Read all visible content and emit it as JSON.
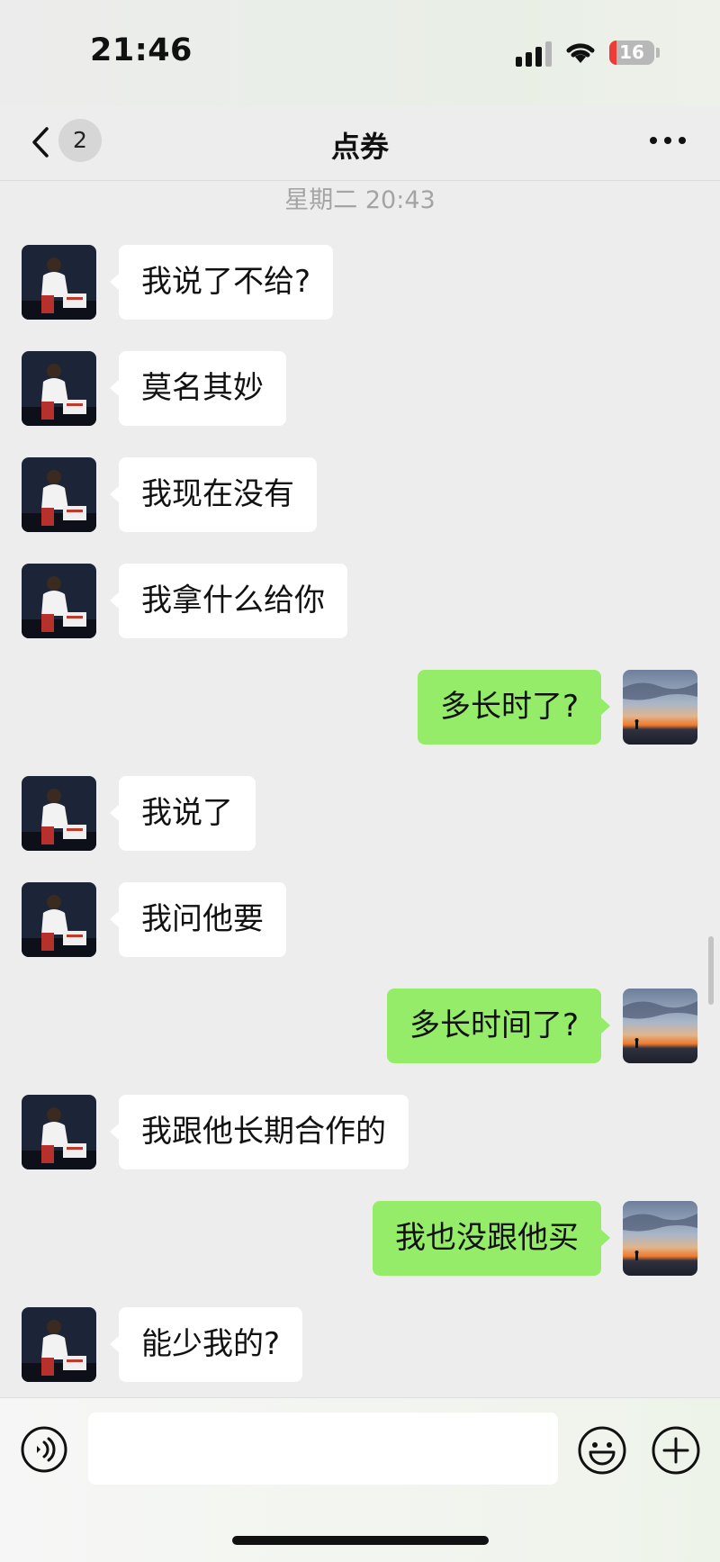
{
  "status_bar": {
    "time": "21:46",
    "battery_level": "16",
    "battery_color": "#ef3b37"
  },
  "nav": {
    "unread_count": "2",
    "title": "点券",
    "back_icon": "chevron-left-icon",
    "more_icon": "more-dots-icon"
  },
  "chat": {
    "timestamp": "星期二 20:43",
    "messages": [
      {
        "from": "other",
        "text": "我说了不给?"
      },
      {
        "from": "other",
        "text": "莫名其妙"
      },
      {
        "from": "other",
        "text": "我现在没有"
      },
      {
        "from": "other",
        "text": "我拿什么给你"
      },
      {
        "from": "me",
        "text": "多长时了?"
      },
      {
        "from": "other",
        "text": "我说了"
      },
      {
        "from": "other",
        "text": "我问他要"
      },
      {
        "from": "me",
        "text": "多长时间了?"
      },
      {
        "from": "other",
        "text": "我跟他长期合作的"
      },
      {
        "from": "me",
        "text": "我也没跟他买"
      },
      {
        "from": "other",
        "text": "能少我的?"
      }
    ]
  },
  "input_bar": {
    "message_value": "",
    "voice_icon": "voice-icon",
    "emoji_icon": "emoji-icon",
    "plus_icon": "plus-icon"
  },
  "colors": {
    "background": "#ededed",
    "incoming_bubble": "#ffffff",
    "outgoing_bubble": "#95ec69",
    "timestamp_text": "#a4a4a4"
  }
}
